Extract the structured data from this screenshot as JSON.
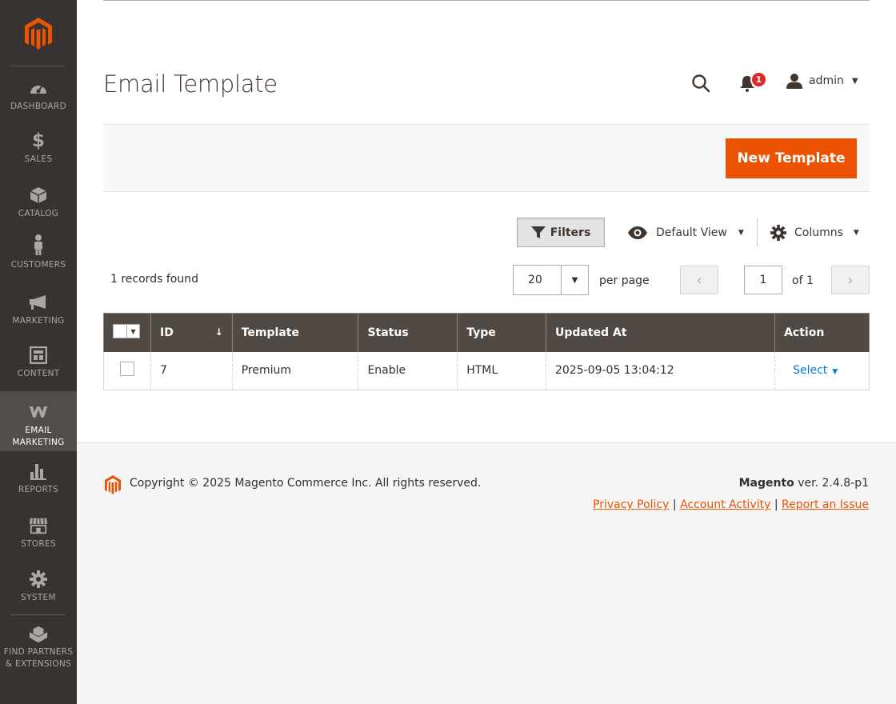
{
  "sidebar": {
    "items": [
      {
        "label": "DASHBOARD",
        "icon": "dashboard-icon"
      },
      {
        "label": "SALES",
        "icon": "dollar-icon"
      },
      {
        "label": "CATALOG",
        "icon": "box-icon"
      },
      {
        "label": "CUSTOMERS",
        "icon": "person-icon"
      },
      {
        "label": "MARKETING",
        "icon": "megaphone-icon"
      },
      {
        "label": "CONTENT",
        "icon": "layout-icon"
      },
      {
        "label": "EMAIL",
        "label2": "MARKETING",
        "icon": "w-icon"
      },
      {
        "label": "REPORTS",
        "icon": "bar-chart-icon"
      },
      {
        "label": "STORES",
        "icon": "store-icon"
      },
      {
        "label": "SYSTEM",
        "icon": "gear-icon"
      },
      {
        "label": "FIND PARTNERS",
        "label2": "& EXTENSIONS",
        "icon": "cubes-icon"
      }
    ]
  },
  "header": {
    "title": "Email Template",
    "notifications_count": "1",
    "user": "admin"
  },
  "actions": {
    "new_template": "New Template"
  },
  "toolbar": {
    "filters": "Filters",
    "view": "Default View",
    "columns": "Columns",
    "records_found": "1 records found",
    "per_page_value": "20",
    "per_page_label": "per page",
    "current_page": "1",
    "of_pages": "of 1"
  },
  "table": {
    "headers": [
      "ID",
      "Template",
      "Status",
      "Type",
      "Updated At",
      "Action"
    ],
    "rows": [
      {
        "id": "7",
        "template": "Premium",
        "status": "Enable",
        "type": "HTML",
        "updated_at": "2025-09-05 13:04:12",
        "action": "Select"
      }
    ]
  },
  "footer": {
    "copyright": "Copyright © 2025 Magento Commerce Inc. All rights reserved.",
    "brand": "Magento",
    "version": "ver. 2.4.8-p1",
    "links": [
      "Privacy Policy",
      "Account Activity",
      "Report an Issue"
    ]
  },
  "colors": {
    "sidebar": "#373330",
    "accent": "#eb5202",
    "table_header": "#514943",
    "link": "#007bdb"
  }
}
